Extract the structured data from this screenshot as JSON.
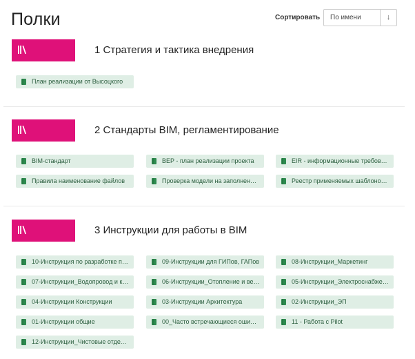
{
  "header": {
    "title": "Полки",
    "sort_label": "Сортировать",
    "sort_value": "По имени",
    "sort_direction_glyph": "↓"
  },
  "colors": {
    "shelf_cover": "#df1179",
    "book_bg": "#dfeee5",
    "book_text": "#2c5e3f",
    "book_icon": "#2d8a4e"
  },
  "shelves": [
    {
      "title": "1 Стратегия и тактика внедрения",
      "books": [
        "План реализации от Высоцкого"
      ]
    },
    {
      "title": "2 Стандарты BIM, регламентирование",
      "books": [
        "BIM-стандарт",
        "BEP - план реализации проекта",
        "EIR - информационные требовани...",
        "Правила наименование файлов",
        "Проверка модели на заполнение п...",
        "Реестр применяемых шаблонов к ..."
      ]
    },
    {
      "title": "3 Инструкции для работы в BIM",
      "books": [
        "10-Инструкция по разработке плаг...",
        "09-Инструкции для ГИПов, ГАПов",
        "08-Инструкции_Маркетинг",
        "07-Инструкции_Водопровод и кан...",
        "06-Инструкции_Отопление и венти...",
        "05-Инструкции_Электроснабжени...",
        "04-Инструкции Конструкции",
        "03-Инструкции Архитектура",
        "02-Инструкции_ЭП",
        "01-Инструкции общие",
        "00_Часто встречающиеся ошибки",
        "11 - Работа с Pilot",
        "12-Инструкции_Чистовые отделки"
      ]
    }
  ]
}
